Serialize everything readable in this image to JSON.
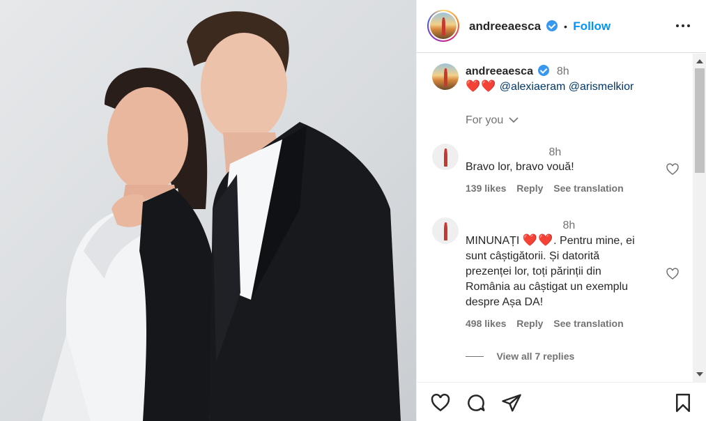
{
  "post": {
    "username": "andreeaesca",
    "separator": "•",
    "follow_label": "Follow",
    "caption": {
      "username": "andreeaesca",
      "time": "8h",
      "hearts": "❤️❤️",
      "mention_1": "@alexiaeram",
      "mention_2": "@arismelkior"
    },
    "sort_label": "For you"
  },
  "comments": [
    {
      "time": "8h",
      "text": "Bravo lor, bravo vouă!",
      "likes": "139 likes",
      "reply": "Reply",
      "translate": "See translation"
    },
    {
      "time": "8h",
      "text_before": "MINUNAȚI",
      "hearts": "❤️❤️",
      "text_after": ". Pentru mine, ei",
      "lines": [
        "sunt câștigătorii. Și datorită",
        "prezenței lor, toți părinții din",
        "România au câștigat un exemplu",
        "despre Așa DA!"
      ],
      "likes": "498 likes",
      "reply": "Reply",
      "translate": "See translation",
      "view_replies": "View all 7 replies"
    }
  ],
  "colors": {
    "accent": "#0095f6",
    "verified": "#3897f0",
    "heart": "#e0245e",
    "muted": "#737373"
  },
  "icons": [
    "verified-badge-icon",
    "more-options-icon",
    "chevron-down-icon",
    "heart-icon",
    "comment-icon",
    "share-icon",
    "bookmark-icon"
  ]
}
